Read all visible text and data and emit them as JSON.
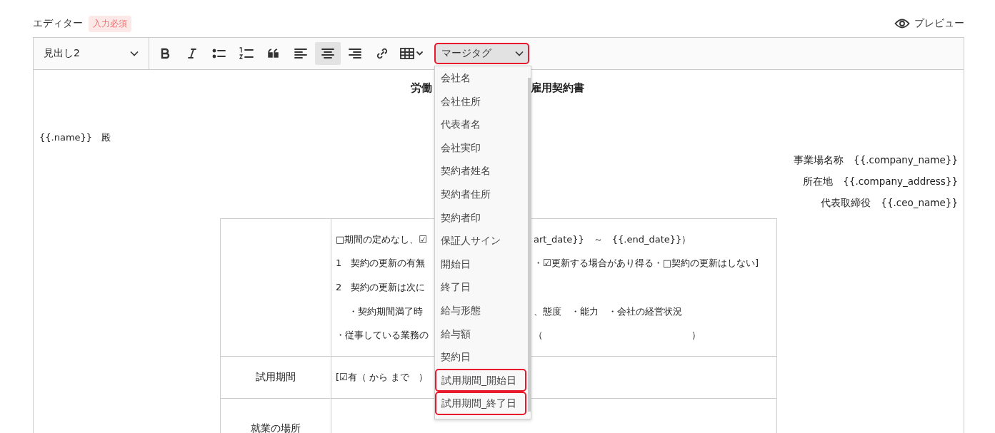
{
  "header": {
    "label": "エディター",
    "badge": "入力必須",
    "preview": "プレビュー"
  },
  "toolbar": {
    "heading": "見出し2",
    "tools": [
      {
        "kind": "bold",
        "selected": false
      },
      {
        "kind": "italic",
        "selected": false
      },
      {
        "kind": "bullet-list",
        "selected": false
      },
      {
        "kind": "numbered-list",
        "selected": false
      },
      {
        "kind": "quote",
        "selected": false
      },
      {
        "kind": "align-left",
        "selected": false
      },
      {
        "kind": "align-center",
        "selected": true
      },
      {
        "kind": "align-right",
        "selected": false
      },
      {
        "kind": "link",
        "selected": false
      },
      {
        "kind": "table",
        "selected": false
      }
    ],
    "merge": {
      "label": "マージタグ",
      "highlighted": true,
      "expanded": true,
      "items": [
        {
          "label": "会社名",
          "highlighted": false
        },
        {
          "label": "会社住所",
          "highlighted": false
        },
        {
          "label": "代表者名",
          "highlighted": false
        },
        {
          "label": "会社実印",
          "highlighted": false
        },
        {
          "label": "契約者姓名",
          "highlighted": false
        },
        {
          "label": "契約者住所",
          "highlighted": false
        },
        {
          "label": "契約者印",
          "highlighted": false
        },
        {
          "label": "保証人サイン",
          "highlighted": false
        },
        {
          "label": "開始日",
          "highlighted": false
        },
        {
          "label": "終了日",
          "highlighted": false
        },
        {
          "label": "給与形態",
          "highlighted": false
        },
        {
          "label": "給与額",
          "highlighted": false
        },
        {
          "label": "契約日",
          "highlighted": false
        },
        {
          "label": "試用期間_開始日",
          "highlighted": true
        },
        {
          "label": "試用期間_終了日",
          "highlighted": true
        }
      ]
    }
  },
  "document": {
    "title": {
      "left": "労働",
      "right": "雇用契約書"
    },
    "addressee": "{{.name}}　殿",
    "company_lines": [
      {
        "label": "事業場名称",
        "value": "{{.company_name}}"
      },
      {
        "label": "所在地",
        "value": "{{.company_address}}"
      },
      {
        "label": "代表取締役",
        "value": "{{.ceo_name}}"
      }
    ],
    "table": {
      "rows": [
        {
          "lines": [
            {
              "left": "□期間の定めなし、☑",
              "right": "art_date}}　～　{{.end_date}}）",
              "indented": false
            },
            {
              "left": "1　契約の更新の有無",
              "right": "・☑更新する場合があり得る・□契約の更新はしない]",
              "indented": false
            },
            {
              "left": "2　契約の更新は次に",
              "indented": false
            },
            {
              "left": "・契約期間満了時",
              "right": "、態度　・能力　・会社の経営状況",
              "indented": true
            },
            {
              "left": "・従事している業務の",
              "right": "（　　　　　　　　　　　　　　　　）",
              "indented": false
            }
          ]
        },
        {
          "header": "試用期間",
          "lines": [
            {
              "left": "[☑有（ から まで　）",
              "indented": false
            }
          ]
        },
        {
          "header": "就業の場所",
          "lines": []
        }
      ]
    }
  }
}
